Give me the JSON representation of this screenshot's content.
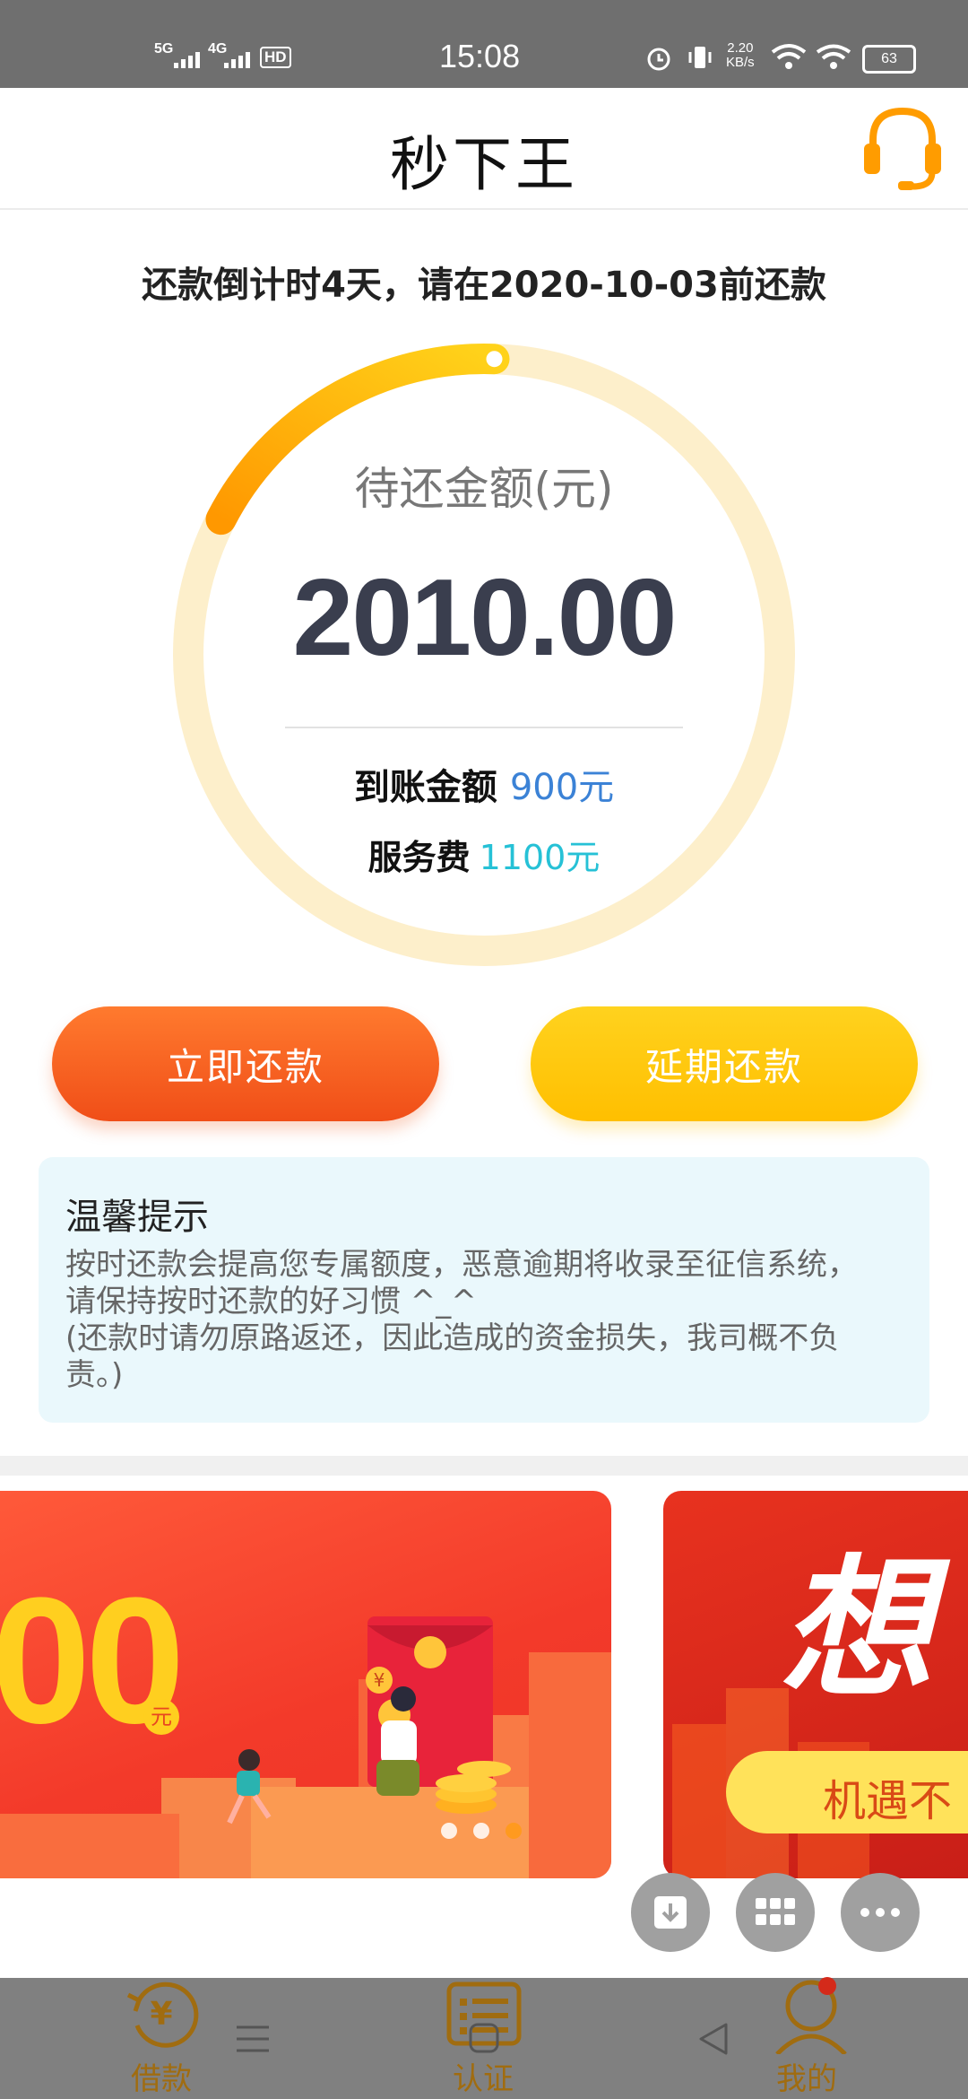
{
  "status_bar": {
    "net1": "5G",
    "net2": "4G",
    "hd": "HD",
    "time": "15:08",
    "speed_value": "2.20",
    "speed_unit": "KB/s",
    "battery": "63"
  },
  "header": {
    "title": "秒下王",
    "icon": "headset-icon",
    "accent_color": "#ff9c00"
  },
  "countdown": "还款倒计时4天，请在2020-10-03前还款",
  "repayment": {
    "label": "待还金额(元)",
    "amount": "2010.00",
    "credited_label": "到账金额",
    "credited_value": "900元",
    "fee_label": "服务费",
    "fee_value": "1100元",
    "progress_ring_fraction": 0.18
  },
  "actions": {
    "repay_now": "立即还款",
    "extend": "延期还款"
  },
  "tips": {
    "title": "温馨提示",
    "lines": [
      "按时还款会提高您专属额度，恶意逾期将收录至征信系统，",
      "请保持按时还款的好习惯 ^_^",
      "(还款时请勿原路返还，因此造成的资金损失，我司概不负",
      "责。)"
    ]
  },
  "banners": [
    {
      "big_text": "00",
      "small_text": "元",
      "coin_symbol": "¥"
    },
    {
      "big_text": "想",
      "small_text": "机遇不"
    }
  ],
  "floating_buttons": [
    "download-icon",
    "grid-icon",
    "more-icon"
  ],
  "bottom_nav": [
    {
      "label": "借款",
      "icon": "loan-yen-icon",
      "active": true
    },
    {
      "label": "认证",
      "icon": "verify-list-icon"
    },
    {
      "label": "我的",
      "icon": "profile-icon",
      "badge": true
    }
  ],
  "system_nav": [
    "menu-icon",
    "home-icon",
    "back-icon"
  ]
}
